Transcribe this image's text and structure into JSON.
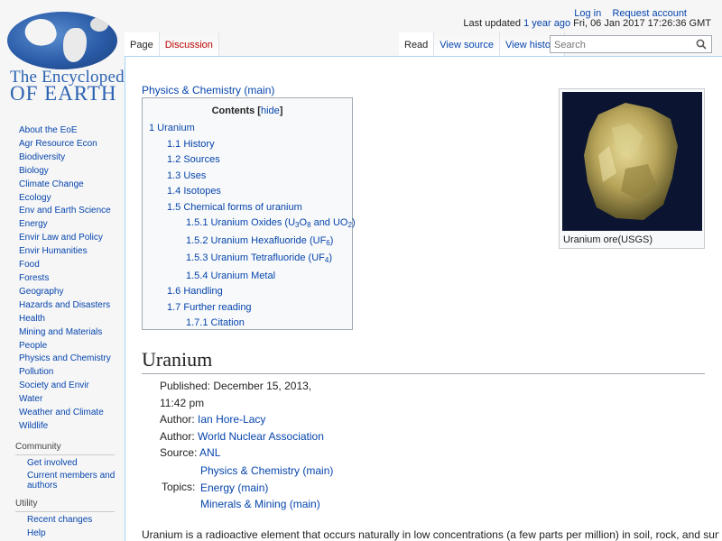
{
  "logo": {
    "line1": "The Encyclopedia",
    "line2": "OF EARTH"
  },
  "personal": {
    "login": "Log in",
    "request_account": "Request account"
  },
  "status": {
    "prefix": "Last updated",
    "relative": "1 year ago",
    "timestamp": "Fri, 06 Jan 2017 17:26:36 GMT"
  },
  "tabs": {
    "left": [
      {
        "label": "Page"
      },
      {
        "label": "Discussion"
      }
    ],
    "right": [
      {
        "label": "Read"
      },
      {
        "label": "View source"
      },
      {
        "label": "View history"
      }
    ]
  },
  "search": {
    "placeholder": "Search"
  },
  "sidebar": {
    "nav": [
      "About the EoE",
      "Agr Resource Econ",
      "Biodiversity",
      "Biology",
      "Climate Change",
      "Ecology",
      "Env and Earth Science",
      "Energy",
      "Envir Law and Policy",
      "Envir Humanities",
      "Food",
      "Forests",
      "Geography",
      "Hazards and Disasters",
      "Health",
      "Mining and Materials",
      "People",
      "Physics and Chemistry",
      "Pollution",
      "Society and Envir",
      "Water",
      "Weather and Climate",
      "Wildlife"
    ],
    "community": {
      "heading": "Community",
      "items": [
        "Get involved",
        "Current members and authors"
      ]
    },
    "utility": {
      "heading": "Utility",
      "items": [
        "Recent changes",
        "Help"
      ]
    }
  },
  "breadcrumb": "Physics & Chemistry (main)",
  "toc": {
    "title": "Contents",
    "hide_label": "hide",
    "items": [
      "1 Uranium",
      "1.1 History",
      "1.2 Sources",
      "1.3 Uses",
      "1.4 Isotopes",
      "1.5 Chemical forms of uranium",
      "1.5.1 Uranium Oxides (U",
      "1.5.2 Uranium Hexafluoride (UF",
      "1.5.3 Uranium Tetrafluoride (UF",
      "1.5.4 Uranium Metal",
      "1.6 Handling",
      "1.7 Further reading",
      "1.7.1 Citation"
    ],
    "oxides": {
      "sub3": "3",
      "o": "O",
      "sub8": "8",
      "and": " and UO",
      "sub2": "2",
      "close": ")"
    },
    "hexa": {
      "sub": "6",
      "close": ")"
    },
    "tetra": {
      "sub": "4",
      "close": ")"
    }
  },
  "thumbnail": {
    "caption": "Uranium ore(USGS)"
  },
  "article": {
    "title": "Uranium",
    "published_label": "Published:",
    "published_value": "December 15, 2013, 11:42 pm",
    "author_label": "Author:",
    "author1": "Ian Hore-Lacy",
    "author2": "World Nuclear Association",
    "source_label": "Source:",
    "source": "ANL",
    "topics_label": "Topics:",
    "topics": [
      "Physics & Chemistry (main)",
      "Energy (main)",
      "Minerals & Mining (main)"
    ],
    "intro": "Uranium is a radioactive element that occurs naturally in low concentrations (a few parts per million) in soil, rock, and surface"
  },
  "colors": {
    "link": "#0645ad",
    "new_link": "#ba0000",
    "border": "#a7d7f9",
    "logo_blue": "#2c63b2"
  }
}
